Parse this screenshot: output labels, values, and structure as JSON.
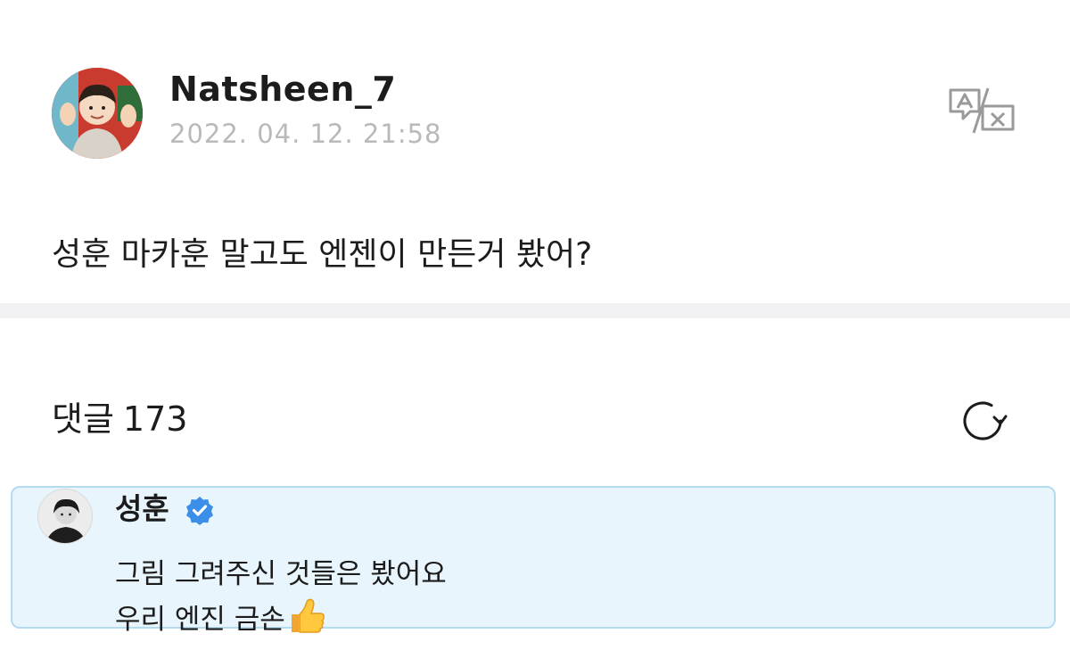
{
  "post": {
    "author_name": "Natsheen_7",
    "timestamp": "2022. 04. 12. 21:58",
    "body": "성훈 마카훈 말고도 엔젠이 만든거 봤어?",
    "translate_icon": "translate-icon"
  },
  "comments": {
    "label": "댓글",
    "count": "173",
    "refresh_icon": "refresh-icon"
  },
  "highlighted_comment": {
    "author": "성훈",
    "verified_icon": "verified-badge-icon",
    "verified_color": "#3b8fe8",
    "lines": [
      "그림 그려주신 것들은 봤어요",
      "우리 엔진 금손"
    ],
    "emoji_icon": "thumbs-up-icon",
    "background_color": "#e9f5fc",
    "border_color": "#b4dbef"
  }
}
